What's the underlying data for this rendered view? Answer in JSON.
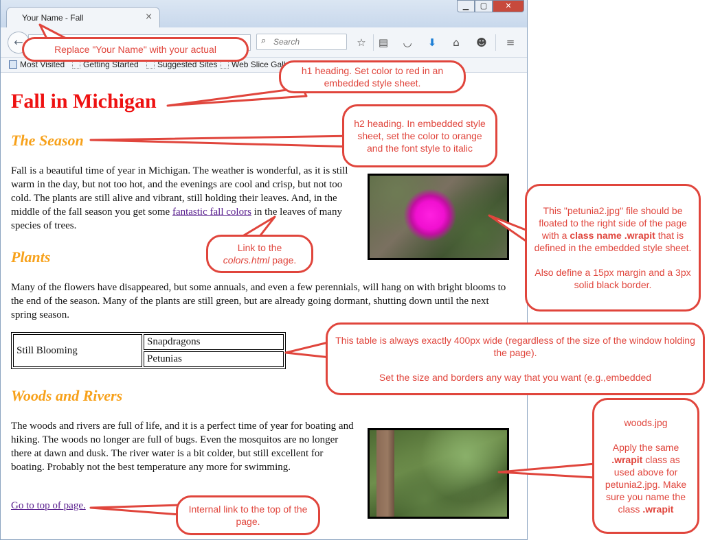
{
  "browser": {
    "tab_title": "Your Name - Fall",
    "tab_close": "×",
    "search_placeholder": "Search",
    "bookmarks": [
      "Most Visited",
      "Getting Started",
      "Suggested Sites",
      "Web Slice Gall"
    ],
    "icons": [
      "back-arrow-icon",
      "search-icon",
      "star-icon",
      "reading-list-icon",
      "pocket-icon",
      "download-icon",
      "home-icon",
      "smiley-icon",
      "menu-icon"
    ]
  },
  "page": {
    "h1": "Fall in Michigan",
    "season_heading": "The Season",
    "season_text_1": "Fall is a beautiful time of year in Michigan. The weather is wonderful, as it is still warm in the day, but not too hot, and the evenings are cool and crisp, but not too cold. The plants are still alive and vibrant, still holding their leaves. And, in the middle of the fall season you get some ",
    "season_link": "fantastic fall colors",
    "season_text_2": " in the leaves of many species of trees.",
    "plants_heading": "Plants",
    "plants_text": "Many of the flowers have disappeared, but some annuals, and even a few perennials, will hang on with bright blooms to the end of the season. Many of the plants are still green, but are already going dormant, shutting down until the next spring season.",
    "table": {
      "label": "Still Blooming",
      "items": [
        "Snapdragons",
        "Petunias"
      ]
    },
    "woods_heading": "Woods and Rivers",
    "woods_text": "The woods and rivers are full of life, and it is a perfect time of year for boating and hiking. The woods no longer are full of bugs. Even the mosquitos are no longer there at dawn and dusk. The river water is a bit colder, but still excellent for boating. Probably not the best temperature any more for swimming.",
    "top_link": "Go to top of page."
  },
  "callouts": {
    "name": "Replace \"Your Name\" with your actual",
    "h1": "h1 heading.  Set color to red in an embedded style sheet.",
    "h2": "h2 heading.  In embedded style sheet, set the color to orange and the font style to italic",
    "petunia_1": "This \"petunia2.jpg\" file should be floated to the right side of the page with a ",
    "petunia_class": "class name .wrapit",
    "petunia_2": " that is defined in the embedded style sheet.",
    "petunia_3": "Also define a 15px margin and a 3px solid black border.",
    "link_1": "Link to the ",
    "link_file": "colors.html",
    "link_2": " page.",
    "table_1": "This table is always exactly 400px wide (regardless of the size of the window holding the page).",
    "table_2": "Set the size and borders any way that you want (e.g.,embedded",
    "woods_1": "woods.jpg",
    "woods_2": "Apply the same ",
    "woods_class": ".wrapit",
    "woods_3": " class as used above for petunia2.jpg.  Make sure you name the class ",
    "woods_class2": ".wrapit",
    "top": "Internal link to the top of the page."
  },
  "colors": {
    "h1": "#ee1111",
    "h2": "#f7a11a",
    "callout": "#e0453c",
    "link": "#551a8b"
  }
}
